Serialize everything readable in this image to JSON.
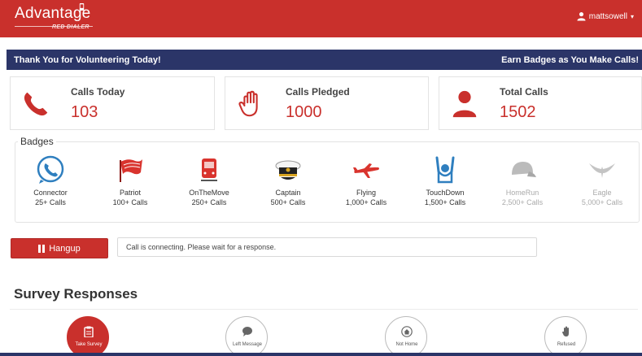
{
  "app": {
    "logo_text": "Advantage",
    "logo_subtitle": "RED DIALER",
    "username": "mattsowell",
    "user_caret": "▾"
  },
  "banner": {
    "left_text": "Thank You for Volunteering Today!",
    "right_text": "Earn Badges as You Make Calls!"
  },
  "stats": [
    {
      "label": "Calls Today",
      "value": "103",
      "icon": "phone-icon"
    },
    {
      "label": "Calls Pledged",
      "value": "1000",
      "icon": "raised-hand-icon"
    },
    {
      "label": "Total Calls",
      "value": "1502",
      "icon": "user-icon"
    }
  ],
  "badges": {
    "title": "Badges",
    "items": [
      {
        "name": "Connector",
        "requirement": "25+ Calls",
        "icon": "phone-bubble-icon",
        "earned": true
      },
      {
        "name": "Patriot",
        "requirement": "100+ Calls",
        "icon": "flag-icon",
        "earned": true
      },
      {
        "name": "OnTheMove",
        "requirement": "250+ Calls",
        "icon": "train-icon",
        "earned": true
      },
      {
        "name": "Captain",
        "requirement": "500+ Calls",
        "icon": "captain-hat-icon",
        "earned": true
      },
      {
        "name": "Flying",
        "requirement": "1,000+ Calls",
        "icon": "airplane-icon",
        "earned": true
      },
      {
        "name": "TouchDown",
        "requirement": "1,500+ Calls",
        "icon": "touchdown-icon",
        "earned": true
      },
      {
        "name": "HomeRun",
        "requirement": "2,500+ Calls",
        "icon": "baseball-cap-icon",
        "earned": false
      },
      {
        "name": "Eagle",
        "requirement": "5,000+ Calls",
        "icon": "eagle-icon",
        "earned": false
      }
    ]
  },
  "call": {
    "hangup_label": "Hangup",
    "status_text": "Call is connecting. Please wait for a response."
  },
  "survey": {
    "title": "Survey Responses",
    "options": [
      {
        "label": "Take Survey",
        "icon": "clipboard-icon",
        "active": true
      },
      {
        "label": "Left Message",
        "icon": "speech-bubble-icon",
        "active": false
      },
      {
        "label": "Not Home",
        "icon": "home-icon",
        "active": false
      },
      {
        "label": "Refused",
        "icon": "hand-stop-icon",
        "active": false
      }
    ]
  },
  "colors": {
    "brand_red": "#c9302c",
    "banner_navy": "#2b3568",
    "locked_gray": "#aaaaaa"
  }
}
